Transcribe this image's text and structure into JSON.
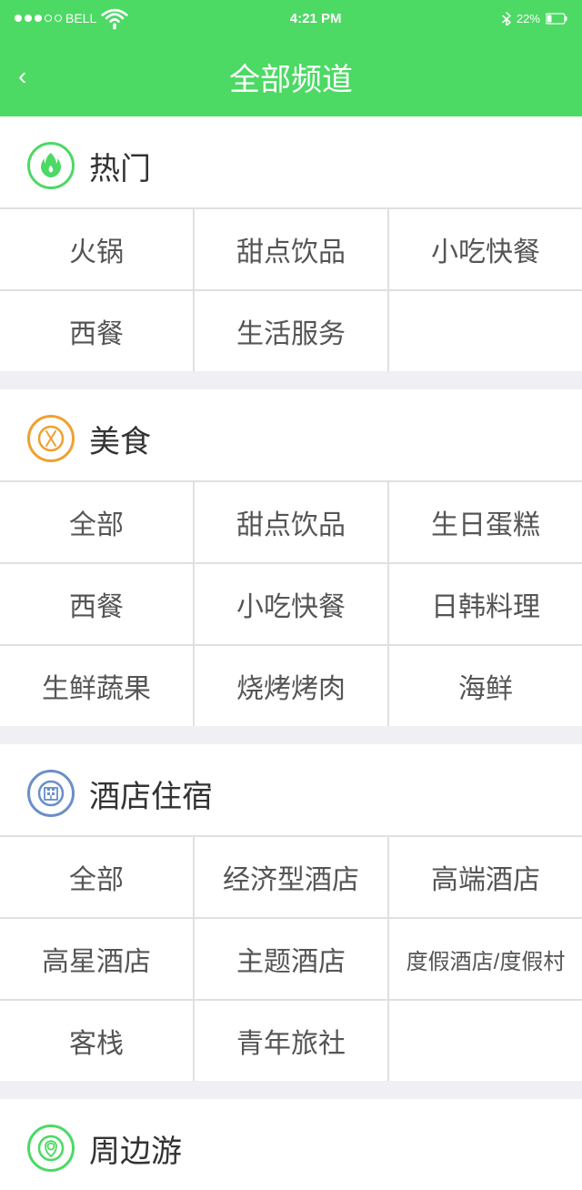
{
  "statusBar": {
    "carrier": "BELL",
    "time": "4:21 PM",
    "battery": "22%"
  },
  "header": {
    "title": "全部频道",
    "back_label": "<"
  },
  "sections": [
    {
      "id": "hot",
      "icon_type": "hot",
      "title": "热门",
      "items": [
        [
          "火锅",
          "甜点饮品",
          "小吃快餐"
        ],
        [
          "西餐",
          "生活服务"
        ]
      ]
    },
    {
      "id": "food",
      "icon_type": "food",
      "title": "美食",
      "items": [
        [
          "全部",
          "甜点饮品",
          "生日蛋糕"
        ],
        [
          "西餐",
          "小吃快餐",
          "日韩料理"
        ],
        [
          "生鲜蔬果",
          "烧烤烤肉",
          "海鲜"
        ]
      ]
    },
    {
      "id": "hotel",
      "icon_type": "hotel",
      "title": "酒店住宿",
      "items": [
        [
          "全部",
          "经济型酒店",
          "高端酒店"
        ],
        [
          "高星酒店",
          "主题酒店",
          "度假酒店/度假村"
        ],
        [
          "客栈",
          "青年旅社"
        ]
      ]
    },
    {
      "id": "travel",
      "icon_type": "travel",
      "title": "周边游",
      "items": []
    }
  ]
}
